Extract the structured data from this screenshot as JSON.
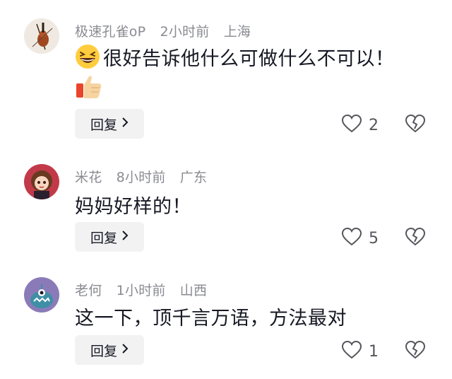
{
  "comments": [
    {
      "username": "极速孔雀oP",
      "time": "2小时前",
      "location": "上海",
      "text": "很好告诉他什么可做什么不可以！",
      "reply_label": "回复",
      "like_count": "2"
    },
    {
      "username": "米花",
      "time": "8小时前",
      "location": "广东",
      "text": "妈妈好样的！",
      "reply_label": "回复",
      "like_count": "5"
    },
    {
      "username": "老何",
      "time": "1小时前",
      "location": "山西",
      "text": "这一下，顶千言万语，方法最对",
      "reply_label": "回复",
      "like_count": "1"
    }
  ],
  "icons": {
    "avatar_1": "violin-avatar",
    "avatar_2": "cartoon-girl-avatar",
    "avatar_3": "monster-avatar",
    "emoji_1": "grinning-squinting-face",
    "emoji_2": "thumbs-up",
    "like": "heart-outline-icon",
    "dislike": "broken-heart-icon",
    "reply_chevron": "chevron-right-icon"
  }
}
